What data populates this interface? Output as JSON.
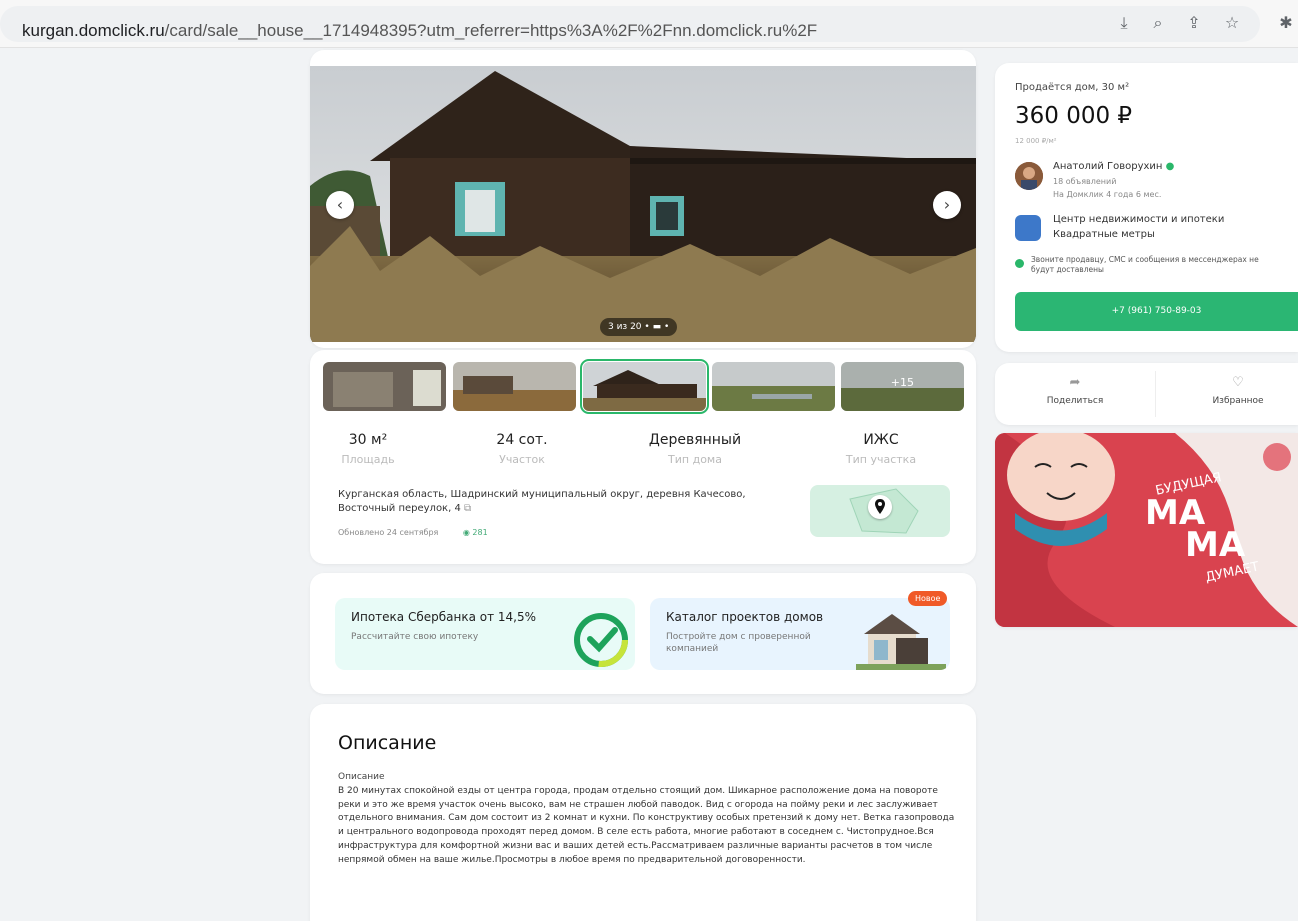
{
  "browser": {
    "url_host": "kurgan.domclick.ru",
    "url_path": "/card/sale__house__1714948395?utm_referrer=https%3A%2F%2Fnn.domclick.ru%2F"
  },
  "gallery": {
    "counter": "3 из 20",
    "more_photos": "+15"
  },
  "stats": [
    {
      "value": "30 м²",
      "label": "Площадь"
    },
    {
      "value": "24 сот.",
      "label": "Участок"
    },
    {
      "value": "Деревянный",
      "label": "Тип дома"
    },
    {
      "value": "ИЖС",
      "label": "Тип участка"
    }
  ],
  "address": {
    "text": "Курганская область, Шадринский муниципальный округ, деревня Качесово, Восточный переулок, 4",
    "updated": "Обновлено 24 сентября",
    "views": "281"
  },
  "promos": {
    "mortgage_title": "Ипотека Сбербанка от 14,5%",
    "mortgage_sub": "Рассчитайте свою ипотеку",
    "catalog_title": "Каталог проектов домов",
    "catalog_sub": "Постройте дом с проверенной компанией",
    "badge": "Новое"
  },
  "description": {
    "heading": "Описание",
    "subheading": "Описание",
    "body": "В 20 минутах спокойной езды от центра города, продам отдельно стоящий дом. Шикарное расположение дома на повороте реки и это же время участок очень высоко, вам не страшен любой паводок. Вид с огорода на пойму реки и лес заслуживает отдельного внимания. Сам дом состоит из 2 комнат и кухни. По конструктиву особых претензий к дому нет. Ветка газопровода и центрального водопровода проходят перед домом. В селе есть работа, многие работают в соседнем с. Чистопрудное.Вся инфраструктура для комфортной жизни вас и ваших детей есть.Рассматриваем различные варианты расчетов в том числе непрямой обмен на ваше жилье.Просмотры в любое время по предварительной договоренности."
  },
  "offer": {
    "title": "Продаётся дом, 30 м²",
    "price": "360 000 ₽",
    "price_per_m2": "12 000 ₽/м²",
    "agent_name": "Анатолий Говорухин",
    "agent_listings": "18 объявлений",
    "agent_tenure": "На Домклик 4 года 6 мес.",
    "agency": "Центр недвижимости и ипотеки Квадратные метры",
    "notice": "Звоните продавцу, СМС и сообщения в мессенджерах не будут доставлены",
    "phone": "+7 (961) 750-89-03"
  },
  "actions": {
    "share": "Поделиться",
    "favorite": "Избранное"
  },
  "ad": {
    "line1": "БУДУЩАЯ",
    "line2": "МА",
    "line3": "МА",
    "line4": "ДУМАЕТ"
  }
}
